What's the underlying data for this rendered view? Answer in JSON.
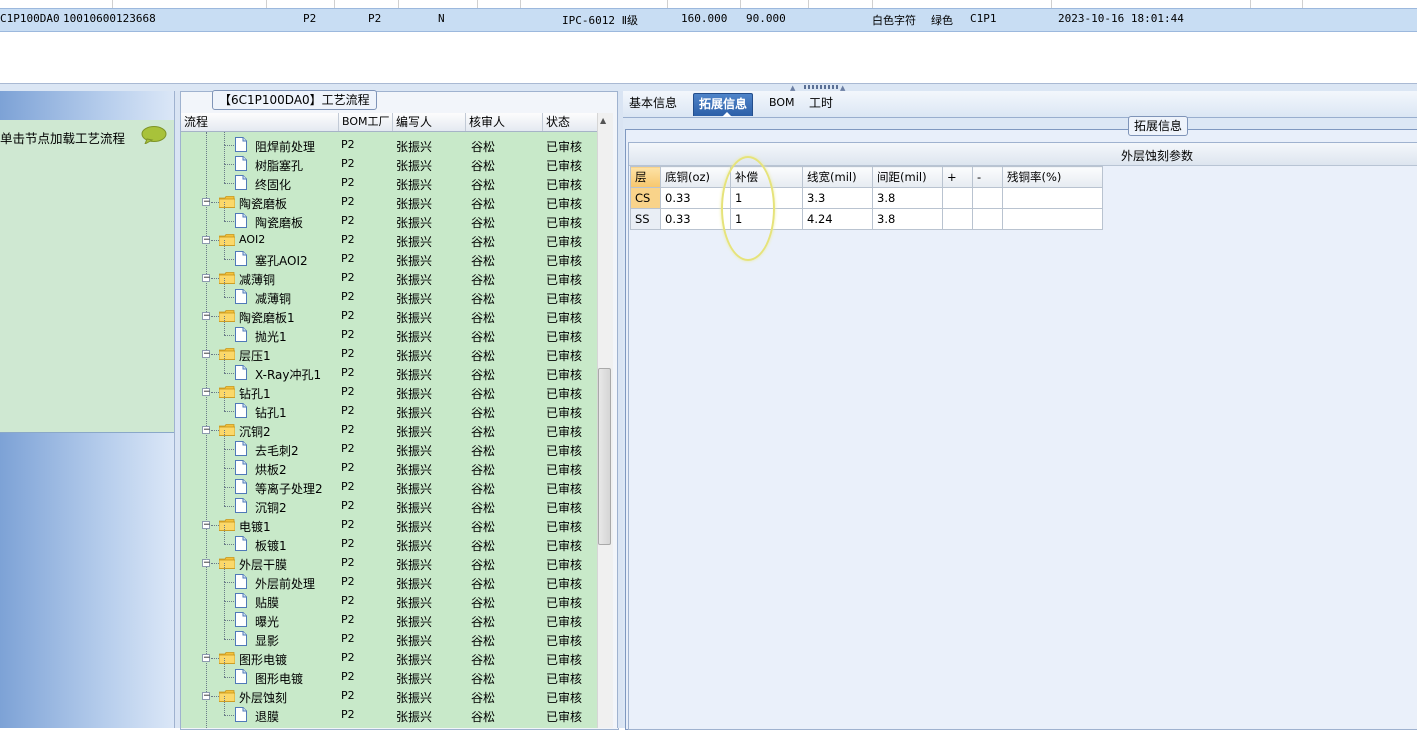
{
  "top_grid": {
    "row": [
      "C1P100DA0",
      "10010600123668",
      "P2",
      "P2",
      "N",
      "IPC-6012 Ⅱ级",
      "160.000",
      "90.000",
      "白色字符",
      "绿色",
      "C1P1",
      "2023-10-16 18:01:44"
    ]
  },
  "left_panel": {
    "hint": "单击节点加载工艺流程"
  },
  "tree_panel": {
    "title": "【6C1P100DA0】工艺流程",
    "headers": {
      "flow": "流程",
      "bom": "BOM工厂",
      "writer": "编写人",
      "reviewer": "核审人",
      "status": "状态"
    },
    "rows": [
      {
        "level": 2,
        "kind": "doc",
        "name": "阻焊前处理",
        "bom": "P2",
        "writer": "张振兴",
        "reviewer": "谷松",
        "status": "已审核"
      },
      {
        "level": 2,
        "kind": "doc",
        "name": "树脂塞孔",
        "bom": "P2",
        "writer": "张振兴",
        "reviewer": "谷松",
        "status": "已审核"
      },
      {
        "level": 2,
        "kind": "doc",
        "name": "终固化",
        "bom": "P2",
        "writer": "张振兴",
        "reviewer": "谷松",
        "status": "已审核"
      },
      {
        "level": 1,
        "kind": "folder",
        "name": "陶瓷磨板",
        "bom": "P2",
        "writer": "张振兴",
        "reviewer": "谷松",
        "status": "已审核"
      },
      {
        "level": 2,
        "kind": "doc",
        "name": "陶瓷磨板",
        "bom": "P2",
        "writer": "张振兴",
        "reviewer": "谷松",
        "status": "已审核"
      },
      {
        "level": 1,
        "kind": "folder",
        "name": "AOI2",
        "bom": "P2",
        "writer": "张振兴",
        "reviewer": "谷松",
        "status": "已审核"
      },
      {
        "level": 2,
        "kind": "doc",
        "name": "塞孔AOI2",
        "bom": "P2",
        "writer": "张振兴",
        "reviewer": "谷松",
        "status": "已审核"
      },
      {
        "level": 1,
        "kind": "folder",
        "name": "减薄铜",
        "bom": "P2",
        "writer": "张振兴",
        "reviewer": "谷松",
        "status": "已审核"
      },
      {
        "level": 2,
        "kind": "doc",
        "name": "减薄铜",
        "bom": "P2",
        "writer": "张振兴",
        "reviewer": "谷松",
        "status": "已审核"
      },
      {
        "level": 1,
        "kind": "folder",
        "name": "陶瓷磨板1",
        "bom": "P2",
        "writer": "张振兴",
        "reviewer": "谷松",
        "status": "已审核"
      },
      {
        "level": 2,
        "kind": "doc",
        "name": "抛光1",
        "bom": "P2",
        "writer": "张振兴",
        "reviewer": "谷松",
        "status": "已审核"
      },
      {
        "level": 1,
        "kind": "folder",
        "name": "层压1",
        "bom": "P2",
        "writer": "张振兴",
        "reviewer": "谷松",
        "status": "已审核"
      },
      {
        "level": 2,
        "kind": "doc",
        "name": "X-Ray冲孔1",
        "bom": "P2",
        "writer": "张振兴",
        "reviewer": "谷松",
        "status": "已审核"
      },
      {
        "level": 1,
        "kind": "folder",
        "name": "钻孔1",
        "bom": "P2",
        "writer": "张振兴",
        "reviewer": "谷松",
        "status": "已审核"
      },
      {
        "level": 2,
        "kind": "doc",
        "name": "钻孔1",
        "bom": "P2",
        "writer": "张振兴",
        "reviewer": "谷松",
        "status": "已审核"
      },
      {
        "level": 1,
        "kind": "folder",
        "name": "沉铜2",
        "bom": "P2",
        "writer": "张振兴",
        "reviewer": "谷松",
        "status": "已审核"
      },
      {
        "level": 2,
        "kind": "doc",
        "name": "去毛刺2",
        "bom": "P2",
        "writer": "张振兴",
        "reviewer": "谷松",
        "status": "已审核"
      },
      {
        "level": 2,
        "kind": "doc",
        "name": "烘板2",
        "bom": "P2",
        "writer": "张振兴",
        "reviewer": "谷松",
        "status": "已审核"
      },
      {
        "level": 2,
        "kind": "doc",
        "name": "等离子处理2",
        "bom": "P2",
        "writer": "张振兴",
        "reviewer": "谷松",
        "status": "已审核"
      },
      {
        "level": 2,
        "kind": "doc",
        "name": "沉铜2",
        "bom": "P2",
        "writer": "张振兴",
        "reviewer": "谷松",
        "status": "已审核"
      },
      {
        "level": 1,
        "kind": "folder",
        "name": "电镀1",
        "bom": "P2",
        "writer": "张振兴",
        "reviewer": "谷松",
        "status": "已审核"
      },
      {
        "level": 2,
        "kind": "doc",
        "name": "板镀1",
        "bom": "P2",
        "writer": "张振兴",
        "reviewer": "谷松",
        "status": "已审核"
      },
      {
        "level": 1,
        "kind": "folder",
        "name": "外层干膜",
        "bom": "P2",
        "writer": "张振兴",
        "reviewer": "谷松",
        "status": "已审核"
      },
      {
        "level": 2,
        "kind": "doc",
        "name": "外层前处理",
        "bom": "P2",
        "writer": "张振兴",
        "reviewer": "谷松",
        "status": "已审核"
      },
      {
        "level": 2,
        "kind": "doc",
        "name": "贴膜",
        "bom": "P2",
        "writer": "张振兴",
        "reviewer": "谷松",
        "status": "已审核"
      },
      {
        "level": 2,
        "kind": "doc",
        "name": "曝光",
        "bom": "P2",
        "writer": "张振兴",
        "reviewer": "谷松",
        "status": "已审核"
      },
      {
        "level": 2,
        "kind": "doc",
        "name": "显影",
        "bom": "P2",
        "writer": "张振兴",
        "reviewer": "谷松",
        "status": "已审核"
      },
      {
        "level": 1,
        "kind": "folder",
        "name": "图形电镀",
        "bom": "P2",
        "writer": "张振兴",
        "reviewer": "谷松",
        "status": "已审核"
      },
      {
        "level": 2,
        "kind": "doc",
        "name": "图形电镀",
        "bom": "P2",
        "writer": "张振兴",
        "reviewer": "谷松",
        "status": "已审核"
      },
      {
        "level": 1,
        "kind": "folder",
        "name": "外层蚀刻",
        "bom": "P2",
        "writer": "张振兴",
        "reviewer": "谷松",
        "status": "已审核"
      },
      {
        "level": 2,
        "kind": "doc",
        "name": "退膜",
        "bom": "P2",
        "writer": "张振兴",
        "reviewer": "谷松",
        "status": "已审核"
      }
    ]
  },
  "tabs": [
    {
      "label": "基本信息",
      "active": false
    },
    {
      "label": "拓展信息",
      "active": true
    },
    {
      "label": "BOM",
      "active": false
    },
    {
      "label": "工时",
      "active": false
    }
  ],
  "extension": {
    "group_title": "拓展信息",
    "param_title": "外层蚀刻参数",
    "columns": [
      "层",
      "底铜(oz)",
      "补偿",
      "线宽(mil)",
      "间距(mil)",
      "+",
      "-",
      "残铜率(%)"
    ],
    "rows": [
      [
        "CS",
        "0.33",
        "1",
        "3.3",
        "3.8",
        "",
        "",
        ""
      ],
      [
        "SS",
        "0.33",
        "1",
        "4.24",
        "3.8",
        "",
        "",
        ""
      ]
    ]
  },
  "colors": {
    "selected_row": "#c8ddf3",
    "tree_background": "#c8e9c9",
    "active_tab": "#2c5fa8",
    "annotation_ring": "#e6e37a"
  }
}
